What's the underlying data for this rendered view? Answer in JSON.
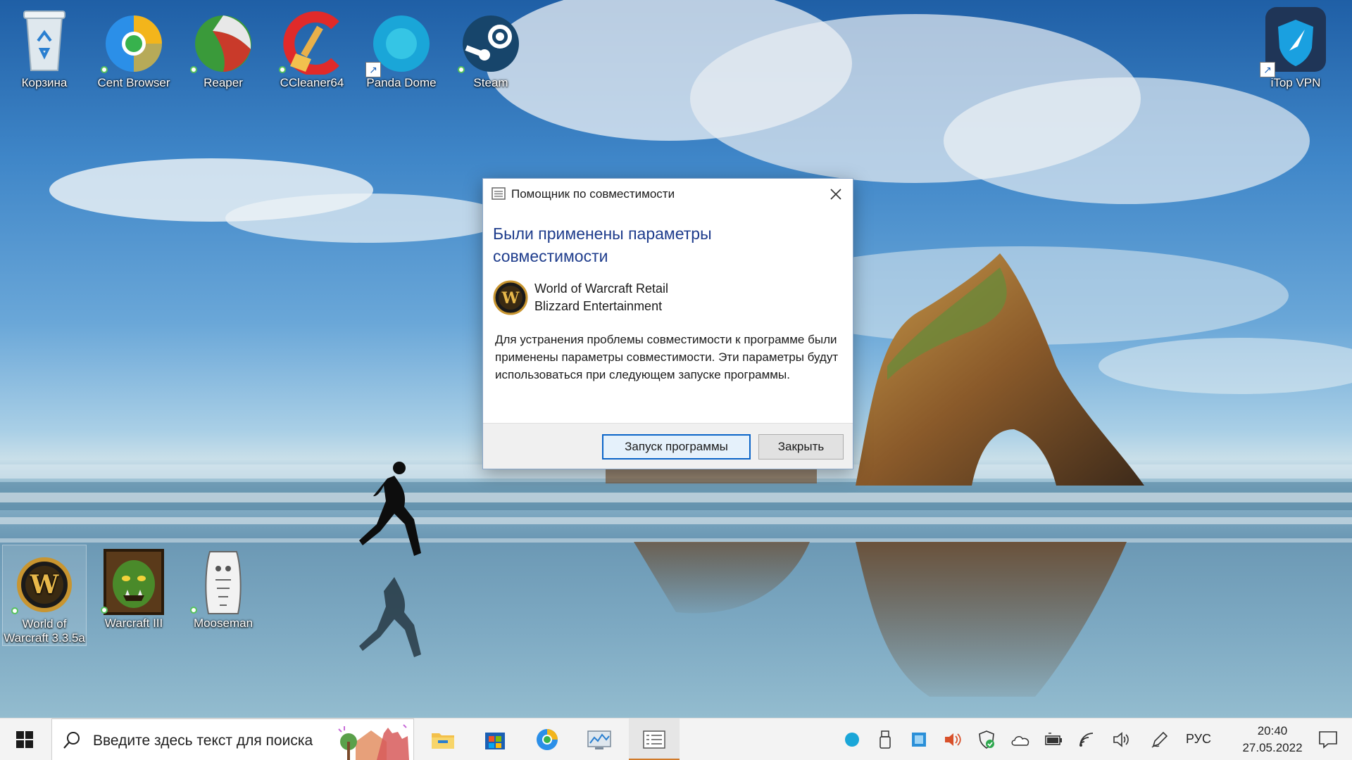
{
  "desktop": {
    "icons_top": [
      {
        "label": "Корзина",
        "icon": "recycle-bin-icon"
      },
      {
        "label": "Cent Browser",
        "icon": "cent-browser-icon"
      },
      {
        "label": "Reaper",
        "icon": "reaper-icon"
      },
      {
        "label": "CCleaner64",
        "icon": "ccleaner-icon"
      },
      {
        "label": "Panda Dome",
        "icon": "panda-dome-icon"
      },
      {
        "label": "Steam",
        "icon": "steam-icon"
      }
    ],
    "icon_right": {
      "label": "iTop VPN",
      "icon": "itop-vpn-icon"
    },
    "icons_bottom": [
      {
        "label": "World of Warcraft 3.3.5a",
        "line1": "World of",
        "line2": "Warcraft 3.3.5a",
        "icon": "wow-icon"
      },
      {
        "label": "Warcraft III",
        "icon": "warcraft-iii-icon"
      },
      {
        "label": "Mooseman",
        "icon": "mooseman-icon"
      }
    ]
  },
  "dialog": {
    "title": "Помощник по совместимости",
    "heading_line1": "Были применены параметры",
    "heading_line2": "совместимости",
    "app_name": "World of Warcraft Retail",
    "app_vendor": "Blizzard Entertainment",
    "description": "Для устранения проблемы совместимости к программе были применены параметры совместимости. Эти параметры будут использоваться при следующем запуске программы.",
    "primary_button": "Запуск программы",
    "secondary_button": "Закрыть"
  },
  "taskbar": {
    "search_placeholder": "Введите здесь текст для поиска",
    "pinned": [
      "file-explorer-icon",
      "microsoft-store-icon",
      "cent-browser-icon",
      "system-monitor-icon",
      "compatibility-assistant-icon"
    ],
    "tray": [
      "panda-dome-tray-icon",
      "usb-drive-icon",
      "network-adapter-icon",
      "audio-app-icon",
      "security-shield-icon",
      "onedrive-icon",
      "battery-icon",
      "wifi-icon",
      "volume-icon",
      "pen-icon"
    ],
    "language": "РУС",
    "time": "20:40",
    "date": "27.05.2022"
  }
}
